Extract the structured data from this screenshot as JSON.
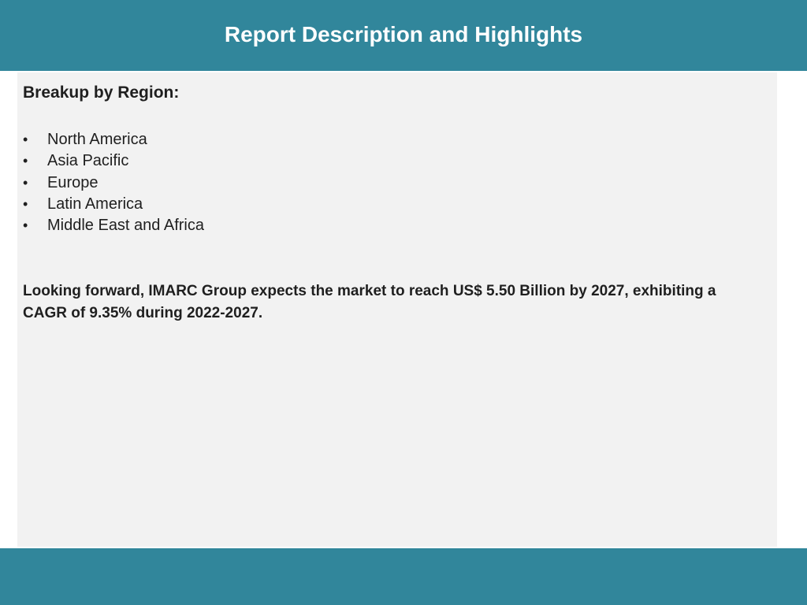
{
  "header": {
    "title": "Report Description and Highlights"
  },
  "content": {
    "heading": "Breakup by Region:",
    "bullet_glyph": "•",
    "regions": [
      "North America",
      "Asia Pacific",
      "Europe",
      "Latin America",
      "Middle East and Africa"
    ],
    "forecast": "Looking forward, IMARC Group expects the market to reach US$ 5.50 Billion by 2027, exhibiting a CAGR of 9.35% during 2022-2027."
  },
  "colors": {
    "header_bar": "#31869b",
    "footer_bar": "#31869b",
    "panel_background": "#f2f2f2",
    "title_text": "#ffffff",
    "body_text": "#1f1f1f"
  }
}
